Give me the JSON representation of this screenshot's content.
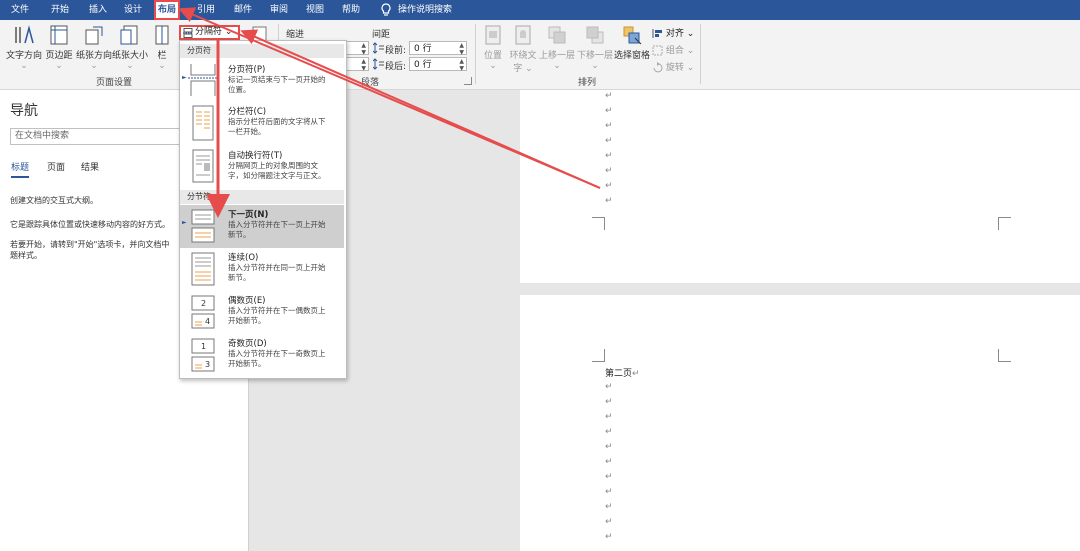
{
  "menu": {
    "tabs": [
      "文件",
      "开始",
      "插入",
      "设计",
      "布局",
      "引用",
      "邮件",
      "审阅",
      "视图",
      "帮助"
    ],
    "active_index": 4,
    "help_search": "操作说明搜索",
    "accent": "#2b579a"
  },
  "ribbon": {
    "text_direction": "文字方向",
    "margins": "页边距",
    "orientation": "纸张方向",
    "size": "纸张大小",
    "columns": "栏",
    "page_setup_group": "页面设置",
    "breaks_button": "分隔符",
    "indent_label": "缩进",
    "spacing_label": "间距",
    "before_label": "段前:",
    "before_value": "0 行",
    "after_label": "段后:",
    "after_value": "0 行",
    "paragraph_group": "段落",
    "position": "位置",
    "wrap_text_line1": "环绕文",
    "wrap_text_line2": "字",
    "bring_forward": "上移一层",
    "send_backward": "下移一层",
    "selection_pane": "选择窗格",
    "align": "对齐",
    "group": "组合",
    "rotate": "旋转",
    "arrange_group": "排列"
  },
  "nav": {
    "title": "导航",
    "search_placeholder": "在文档中搜索",
    "tabs": [
      "标题",
      "页面",
      "结果"
    ],
    "line1": "创建文档的交互式大纲。",
    "line2": "它是跟踪具体位置或快速移动内容的好方式。",
    "line3a": "若要开始，请转到\"开始\"选项卡，并向文档中",
    "line3b": "题样式。"
  },
  "dropdown": {
    "section_page": "分页符",
    "section_section": "分节符",
    "items": [
      {
        "title": "分页符(P)",
        "desc1": "标记一页结束与下一页开始的",
        "desc2": "位置。"
      },
      {
        "title": "分栏符(C)",
        "desc1": "指示分栏符后面的文字将从下",
        "desc2": "一栏开始。"
      },
      {
        "title": "自动换行符(T)",
        "desc1": "分隔网页上的对象周围的文",
        "desc2": "字，如分隔题注文字与正文。"
      },
      {
        "title": "下一页(N)",
        "desc1": "插入分节符并在下一页上开始",
        "desc2": "新节。"
      },
      {
        "title": "连续(O)",
        "desc1": "插入分节符并在同一页上开始",
        "desc2": "新节。"
      },
      {
        "title": "偶数页(E)",
        "desc1": "插入分节符并在下一偶数页上",
        "desc2": "开始新节。"
      },
      {
        "title": "奇数页(D)",
        "desc1": "插入分节符并在下一奇数页上",
        "desc2": "开始新节。"
      }
    ],
    "even_glyph": "2",
    "even_glyph2": "4",
    "odd_glyph": "1",
    "odd_glyph2": "3"
  },
  "document": {
    "paragraph_mark": "↵",
    "page2_text": "第二页"
  },
  "colors": {
    "annotation": "#e74c4c",
    "highlight": "#cfcfcf"
  }
}
